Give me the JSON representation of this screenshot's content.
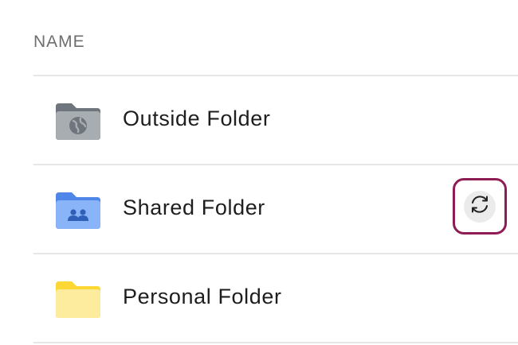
{
  "table": {
    "header": "NAME",
    "rows": [
      {
        "name": "Outside Folder",
        "icon": "globe-folder-icon",
        "icon_color": "#9aa0a6"
      },
      {
        "name": "Shared Folder",
        "icon": "shared-folder-icon",
        "icon_color": "#7aa8f5",
        "action_icon": "sync-icon",
        "action_highlight_color": "#8d1d54"
      },
      {
        "name": "Personal Folder",
        "icon": "personal-folder-icon",
        "icon_color": "#fde48d"
      }
    ]
  }
}
